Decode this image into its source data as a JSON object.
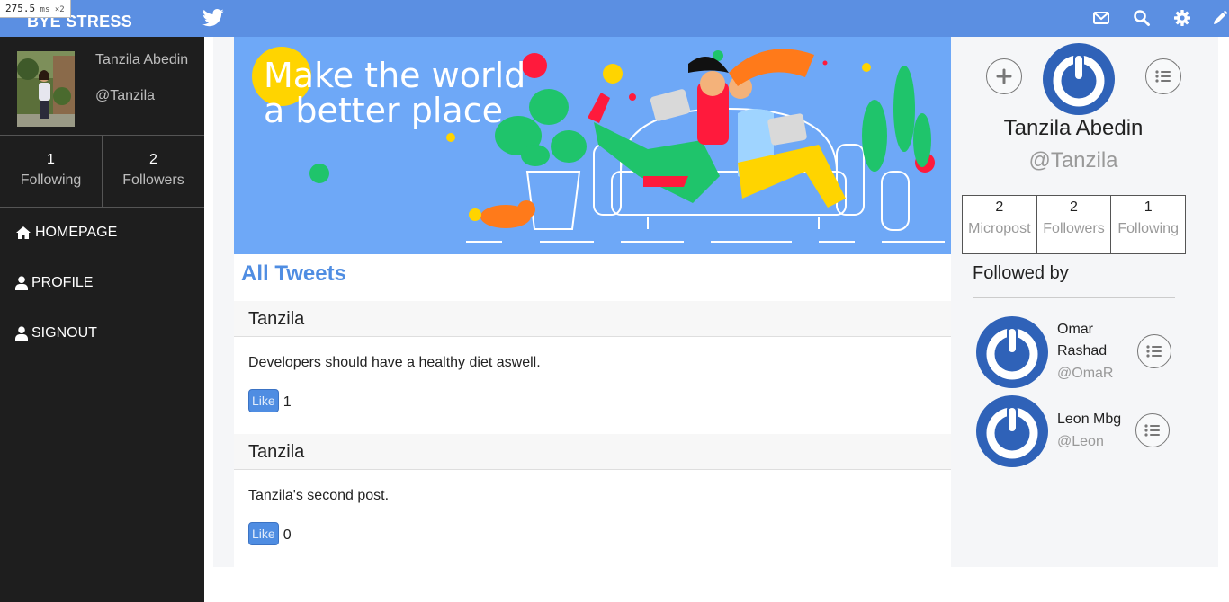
{
  "perf": {
    "value": "275.5",
    "unit": "ms",
    "mult": "×2"
  },
  "brand": "BYE STRESS",
  "colors": {
    "topbar": "#5b8fe2",
    "sidebar": "#1e1e1e",
    "accent": "#4f8de2",
    "banner": "#6ea8f7"
  },
  "topbar_icons": [
    "twitter-icon",
    "envelope-icon",
    "search-icon",
    "gear-icon",
    "pencil-icon"
  ],
  "sidebar": {
    "name": "Tanzila Abedin",
    "handle": "@Tanzila",
    "following_count": "1",
    "following_label": "Following",
    "followers_count": "2",
    "followers_label": "Followers",
    "nav": [
      {
        "label": "HOMEPAGE",
        "icon": "home-icon"
      },
      {
        "label": "PROFILE",
        "icon": "user-icon"
      },
      {
        "label": "SIGNOUT",
        "icon": "user-icon"
      }
    ]
  },
  "banner": {
    "line1": "Make the world",
    "line2": "a better place"
  },
  "feed": {
    "title": "All Tweets",
    "tweets": [
      {
        "author": "Tanzila",
        "text": "Developers should have a healthy diet aswell.",
        "like_label": "Like",
        "likes": "1"
      },
      {
        "author": "Tanzila",
        "text": "Tanzila's second post.",
        "like_label": "Like",
        "likes": "0"
      }
    ]
  },
  "profile": {
    "name": "Tanzila Abedin",
    "handle": "@Tanzila",
    "stats": [
      {
        "value": "2",
        "label": "Micropost"
      },
      {
        "value": "2",
        "label": "Followers"
      },
      {
        "value": "1",
        "label": "Following"
      }
    ],
    "followed_by_title": "Followed by",
    "followers": [
      {
        "name_line1": "Omar",
        "name_line2": "Rashad",
        "handle": "@OmaR"
      },
      {
        "name_line1": "Leon Mbg",
        "name_line2": "",
        "handle": "@Leon"
      }
    ]
  }
}
